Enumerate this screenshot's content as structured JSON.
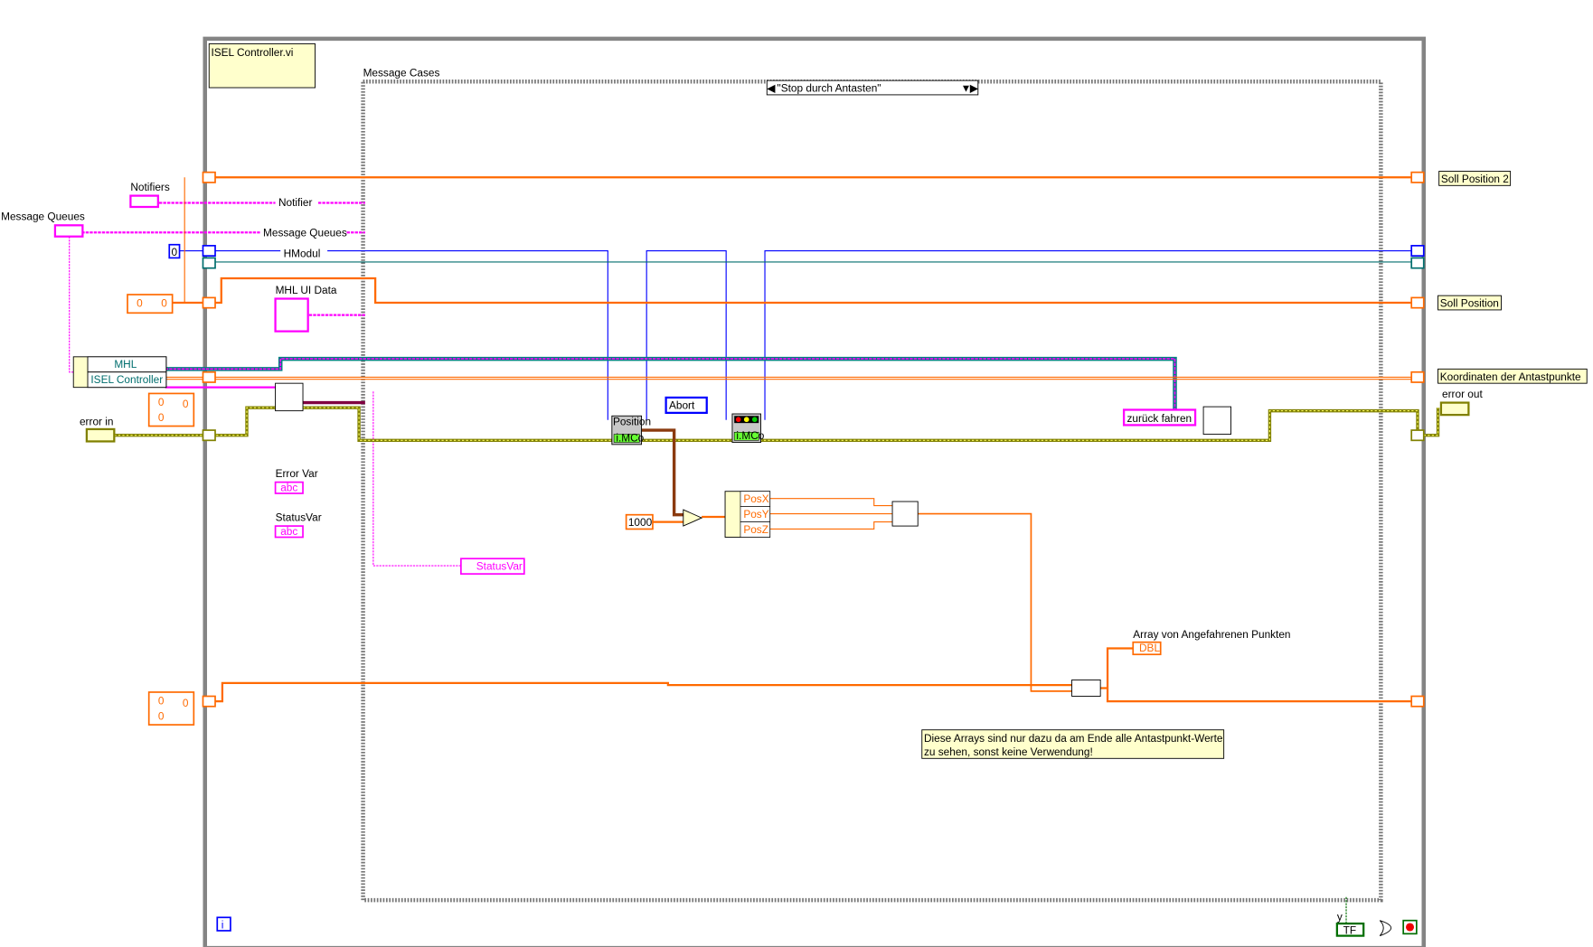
{
  "vi_title": "ISEL Controller.vi",
  "case_structure": {
    "label": "Message Cases",
    "selector_value": "\"Stop durch Antasten\""
  },
  "inputs": {
    "notifiers": "Notifiers",
    "message_queues": "Message Queues",
    "error_in": "error in",
    "hmodul_const": "0",
    "soll_const_a": "0",
    "soll_const_b": "0",
    "arr1": [
      "0",
      "0",
      "0"
    ],
    "arr2": [
      "0",
      "0",
      "0"
    ]
  },
  "wire_labels": {
    "notifier": "Notifier",
    "message_queues": "Message Queues",
    "hmodul": "HModul",
    "mhl_ui_data": "MHL UI Data"
  },
  "cluster": {
    "line1": "MHL",
    "line2": "ISEL Controller"
  },
  "locals": {
    "error_var": "Error Var",
    "status_var": "StatusVar",
    "status_var_ref": "StatusVar",
    "abc": "abc"
  },
  "nodes": {
    "position_node": "Position",
    "imco": "i.MCo",
    "abort_enum": "Abort",
    "const_1000": "1000",
    "unbundle": [
      "PosX",
      "PosY",
      "PosZ"
    ],
    "zurueck": "zurück fahren",
    "array_label": "Array von Angefahrenen Punkten",
    "dbl": "DBL",
    "stop_label": "y",
    "tf": "TF"
  },
  "outputs": {
    "soll_position_2": "Soll Position 2",
    "soll_position": "Soll Position",
    "koordinaten": "Koordinaten der Antastpunkte",
    "error_out": "error out"
  },
  "comment": {
    "line1": "Diese Arrays sind nur dazu da am Ende alle Antastpunkt-Werte",
    "line2": "zu sehen, sonst keine Verwendung!"
  },
  "iteration": "i",
  "colors": {
    "orange": "#ff6a00",
    "pink": "#ff00ff",
    "blue": "#0000ff",
    "teal": "#006e6e",
    "olive": "#808000",
    "loop_gray": "#848484"
  }
}
